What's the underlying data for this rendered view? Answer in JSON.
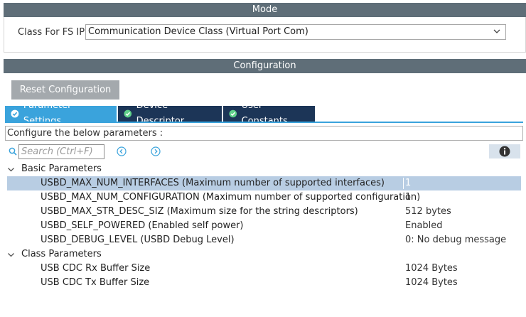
{
  "mode": {
    "header": "Mode",
    "class_label": "Class For FS IP",
    "class_value": "Communication Device Class (Virtual Port Com)"
  },
  "configuration": {
    "header": "Configuration",
    "reset_label": "Reset Configuration",
    "tabs": [
      {
        "label": "Parameter Settings",
        "active": true
      },
      {
        "label": "Device Descriptor",
        "active": false
      },
      {
        "label": "User Constants",
        "active": false
      }
    ],
    "configure_text": "Configure the below parameters :",
    "search_placeholder": "Search (Ctrl+F)",
    "groups": [
      {
        "label": "Basic Parameters",
        "params": [
          {
            "name": "USBD_MAX_NUM_INTERFACES (Maximum number of supported interfaces)",
            "value": "1",
            "selected": true
          },
          {
            "name": "USBD_MAX_NUM_CONFIGURATION (Maximum number of supported configuration)",
            "value": "1"
          },
          {
            "name": "USBD_MAX_STR_DESC_SIZ (Maximum size for the string descriptors)",
            "value": "512 bytes"
          },
          {
            "name": "USBD_SELF_POWERED (Enabled self power)",
            "value": "Enabled"
          },
          {
            "name": "USBD_DEBUG_LEVEL (USBD Debug Level)",
            "value": "0: No debug message"
          }
        ]
      },
      {
        "label": "Class Parameters",
        "params": [
          {
            "name": "USB CDC Rx Buffer Size",
            "value": "1024 Bytes"
          },
          {
            "name": "USB CDC Tx Buffer Size",
            "value": "1024 Bytes"
          }
        ]
      }
    ]
  },
  "colors": {
    "header_bg": "#5f6e78",
    "tab_active": "#3aa3dc",
    "tab_inactive": "#1c3557",
    "selected_row": "#b8cde3"
  }
}
